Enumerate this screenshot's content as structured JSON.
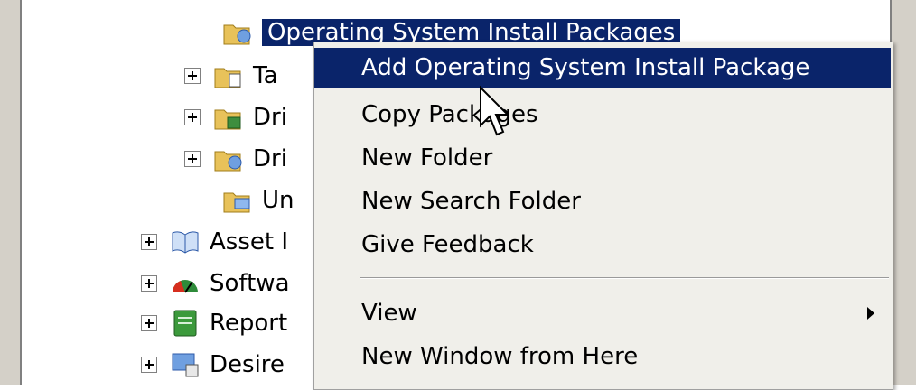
{
  "tree": {
    "selected_node": "Operating System Install Packages",
    "nodes": [
      {
        "label": "Ta",
        "icon": "task-sequence-folder-icon"
      },
      {
        "label": "Dri",
        "icon": "driver-folder-icon"
      },
      {
        "label": "Dri",
        "icon": "driver-package-folder-icon"
      },
      {
        "label": "Un",
        "icon": "unknown-computers-folder-icon"
      },
      {
        "label": "Asset I",
        "icon": "asset-intelligence-icon"
      },
      {
        "label": "Softwa",
        "icon": "software-metering-icon"
      },
      {
        "label": "Report",
        "icon": "reporting-icon"
      },
      {
        "label": "Desire",
        "icon": "desired-configuration-icon"
      }
    ]
  },
  "context_menu": {
    "items": [
      {
        "label": "Add Operating System Install Package",
        "highlighted": true
      },
      {
        "label": "Copy Packages"
      },
      {
        "label": "New Folder"
      },
      {
        "label": "New Search Folder"
      },
      {
        "label": "Give Feedback"
      },
      {
        "label": "View",
        "has_submenu": true
      },
      {
        "label": "New Window from Here"
      }
    ]
  },
  "colors": {
    "selection": "#0a246a",
    "menu_background": "#f0efea"
  }
}
